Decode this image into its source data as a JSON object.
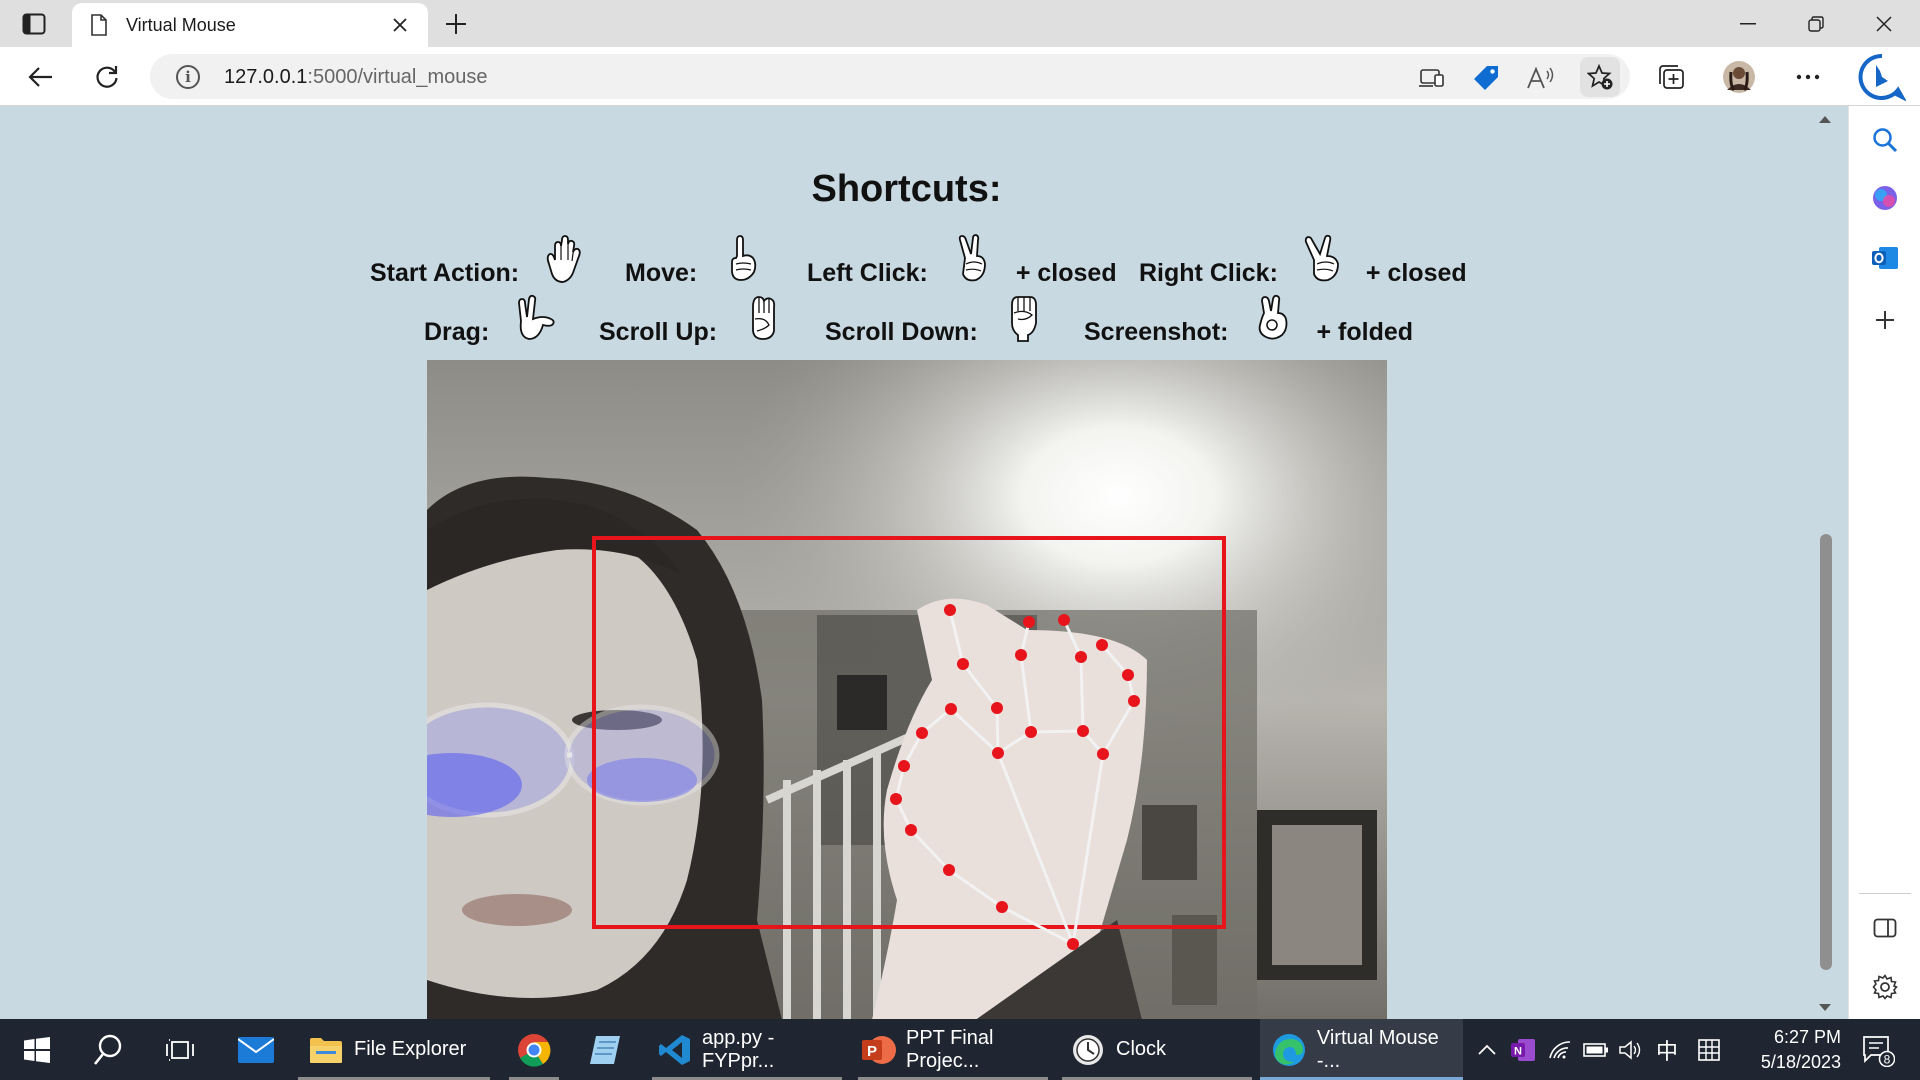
{
  "browser": {
    "tab": {
      "title": "Virtual Mouse"
    },
    "address": {
      "host": "127.0.0.1",
      "path": ":5000/virtual_mouse"
    }
  },
  "page": {
    "heading": "Shortcuts:",
    "shortcuts_row1": [
      {
        "label": "Start Action:",
        "gesture_icon": "open-hand-icon",
        "suffix": ""
      },
      {
        "label": "Move:",
        "gesture_icon": "index-up-hand-icon",
        "suffix": ""
      },
      {
        "label": "Left Click:",
        "gesture_icon": "peace-hand-icon",
        "suffix": "+ closed"
      },
      {
        "label": "Right Click:",
        "gesture_icon": "peace-spread-hand-icon",
        "suffix": "+ closed"
      }
    ],
    "shortcuts_row2": [
      {
        "label": "Drag:",
        "gesture_icon": "pointing-hand-icon",
        "suffix": ""
      },
      {
        "label": "Scroll Up:",
        "gesture_icon": "fist-thumb-hand-icon",
        "suffix": ""
      },
      {
        "label": "Scroll Down:",
        "gesture_icon": "fist-hand-icon",
        "suffix": ""
      },
      {
        "label": "Screenshot:",
        "gesture_icon": "ok-hand-icon",
        "suffix": "+ folded"
      }
    ],
    "webcam": {
      "tracking_box_color": "#e8141c",
      "landmark_color": "#e8141c"
    }
  },
  "taskbar": {
    "items": [
      {
        "label": "File Explorer",
        "icon": "folder-icon"
      },
      {
        "label": "",
        "icon": "chrome-icon"
      },
      {
        "label": "",
        "icon": "notes-icon"
      },
      {
        "label": "app.py - FYPpr...",
        "icon": "vscode-icon"
      },
      {
        "label": "PPT Final Projec...",
        "icon": "powerpoint-icon"
      },
      {
        "label": "Clock",
        "icon": "clock-icon"
      },
      {
        "label": "Virtual Mouse -...",
        "icon": "edge-icon"
      }
    ],
    "ime_lang": "中",
    "time": "6:27 PM",
    "date": "5/18/2023",
    "notification_count": "8"
  }
}
